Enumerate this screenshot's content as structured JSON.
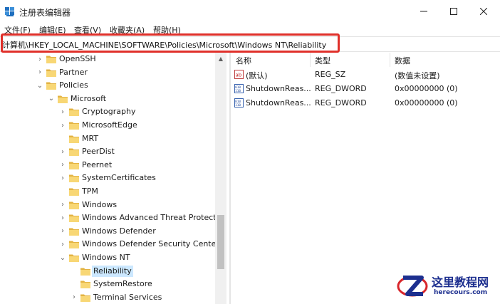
{
  "window": {
    "title": "注册表编辑器",
    "controls": {
      "minimize": "—",
      "maximize": "☐",
      "close": "✕"
    }
  },
  "menu": [
    {
      "label": "文件(F)"
    },
    {
      "label": "编辑(E)"
    },
    {
      "label": "查看(V)"
    },
    {
      "label": "收藏夹(A)"
    },
    {
      "label": "帮助(H)"
    }
  ],
  "address": {
    "path": "计算机\\HKEY_LOCAL_MACHINE\\SOFTWARE\\Policies\\Microsoft\\Windows NT\\Reliability",
    "highlight_color": "#e0302a"
  },
  "tree": [
    {
      "label": "OpenSSH",
      "chevron": "›",
      "level": 0
    },
    {
      "label": "Partner",
      "chevron": "›",
      "level": 0
    },
    {
      "label": "Policies",
      "chevron": "⌄",
      "level": 0
    },
    {
      "label": "Microsoft",
      "chevron": "⌄",
      "level": 1
    },
    {
      "label": "Cryptography",
      "chevron": "›",
      "level": 2
    },
    {
      "label": "MicrosoftEdge",
      "chevron": "›",
      "level": 2
    },
    {
      "label": "MRT",
      "chevron": "",
      "level": 2
    },
    {
      "label": "PeerDist",
      "chevron": "›",
      "level": 2
    },
    {
      "label": "Peernet",
      "chevron": "›",
      "level": 2
    },
    {
      "label": "SystemCertificates",
      "chevron": "›",
      "level": 2
    },
    {
      "label": "TPM",
      "chevron": "",
      "level": 2
    },
    {
      "label": "Windows",
      "chevron": "›",
      "level": 2
    },
    {
      "label": "Windows Advanced Threat Protecti",
      "chevron": "›",
      "level": 2
    },
    {
      "label": "Windows Defender",
      "chevron": "›",
      "level": 2
    },
    {
      "label": "Windows Defender Security Center",
      "chevron": "›",
      "level": 2
    },
    {
      "label": "Windows NT",
      "chevron": "⌄",
      "level": 2
    },
    {
      "label": "Reliability",
      "chevron": "",
      "level": 3,
      "selected": true
    },
    {
      "label": "SystemRestore",
      "chevron": "",
      "level": 3
    },
    {
      "label": "Terminal Services",
      "chevron": "›",
      "level": 3
    }
  ],
  "list": {
    "columns": [
      "名称",
      "类型",
      "数据"
    ],
    "rows": [
      {
        "icon": "string-value-icon",
        "name": "(默认)",
        "type": "REG_SZ",
        "data": "(数值未设置)"
      },
      {
        "icon": "dword-value-icon",
        "name": "ShutdownReas...",
        "type": "REG_DWORD",
        "data": "0x00000000 (0)"
      },
      {
        "icon": "dword-value-icon",
        "name": "ShutdownReas...",
        "type": "REG_DWORD",
        "data": "0x00000000 (0)"
      }
    ]
  },
  "watermark": {
    "title": "这里教程网",
    "url": "herecours.com",
    "color": "#1d2f8f"
  },
  "colors": {
    "selection": "#cce8ff",
    "folder": "#f8d775",
    "folder_dark": "#e3b342"
  }
}
